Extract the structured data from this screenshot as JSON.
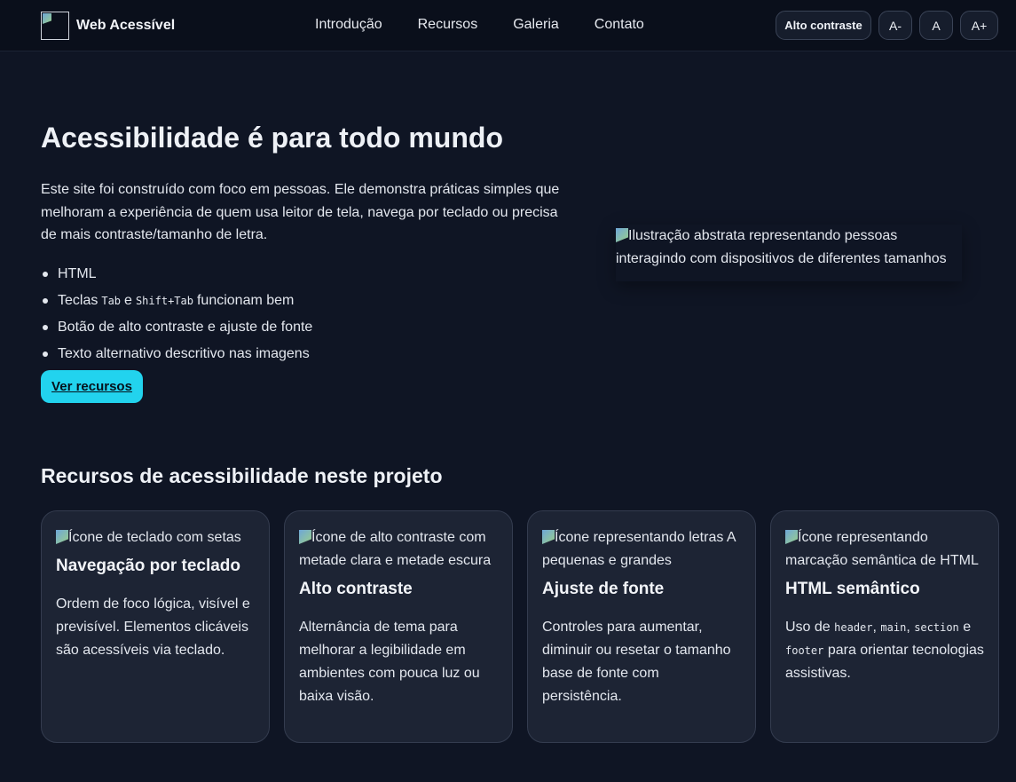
{
  "header": {
    "brand": "Web Acessível",
    "nav": [
      "Introdução",
      "Recursos",
      "Galeria",
      "Contato"
    ],
    "controls": {
      "contrast": "Alto contraste",
      "font_decrease": "A-",
      "font_reset": "A",
      "font_increase": "A+"
    }
  },
  "hero": {
    "title": "Acessibilidade é para todo mundo",
    "text": "Este site foi construído com foco em pessoas. Ele demonstra práticas simples que melhoram a experiência de quem usa leitor de tela, navega por teclado ou precisa de mais contraste/tamanho de letra.",
    "list": {
      "item1": "HTML",
      "item2_pre": "Teclas",
      "item2_key1": "Tab",
      "item2_mid": "e",
      "item2_key2": "Shift+Tab",
      "item2_post": "funcionam bem",
      "item3": "Botão de alto contraste e ajuste de fonte",
      "item4": "Texto alternativo descritivo nas imagens"
    },
    "cta": "Ver recursos",
    "image_alt": "Ilustração abstrata representando pessoas interagindo com dispositivos de diferentes tamanhos"
  },
  "features": {
    "title": "Recursos de acessibilidade neste projeto",
    "cards": [
      {
        "alt": "Ícone de teclado com setas",
        "title": "Navegação por teclado",
        "text": "Ordem de foco lógica, visível e previsível. Elementos clicáveis são acessíveis via teclado."
      },
      {
        "alt": "Ícone de alto contraste com metade clara e metade escura",
        "title": "Alto contraste",
        "text": "Alternância de tema para melhorar a legibilidade em ambientes com pouca luz ou baixa visão."
      },
      {
        "alt": "Ícone representando letras A pequenas e grandes",
        "title": "Ajuste de fonte",
        "text": "Controles para aumentar, diminuir ou resetar o tamanho base de fonte com persistência."
      },
      {
        "alt": "Ícone representando marcação semântica de HTML",
        "title": "HTML semântico",
        "text_pre": "Uso de",
        "code1": "header",
        "code2": "main",
        "code3": "section",
        "text_and": "e",
        "code4": "footer",
        "text_post": "para orientar tecnologias assistivas."
      }
    ]
  }
}
